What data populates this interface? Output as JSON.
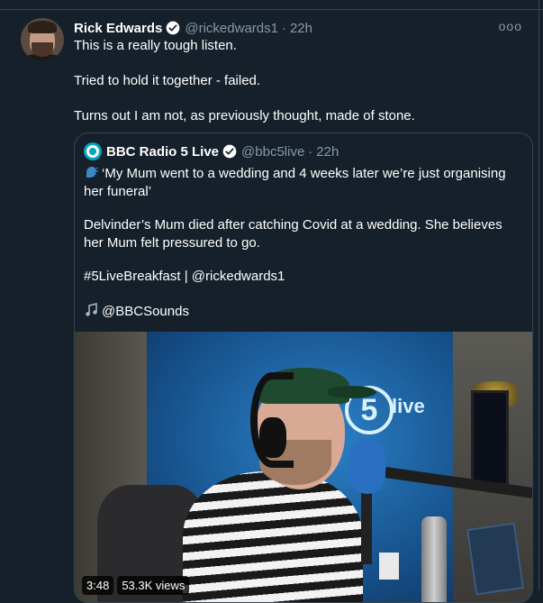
{
  "tweet": {
    "author_name": "Rick Edwards",
    "author_handle": "@rickedwards1",
    "separator": "·",
    "time": "22h",
    "more": "ooo",
    "lines": [
      "This is a really tough listen.",
      "Tried to hold it together - failed.",
      "Turns out I am not, as previously thought, made of stone."
    ]
  },
  "quoted": {
    "author_name": "BBC Radio 5 Live",
    "author_handle": "@bbc5live",
    "separator": "·",
    "time": "22h",
    "lines": [
      "‘My Mum went to a wedding and 4 weeks later we’re just organising her funeral’",
      "Delvinder’s Mum died after catching Covid at a wedding.  She believes her Mum felt pressured to go.",
      "#5LiveBreakfast | @rickedwards1",
      "@BBCSounds"
    ],
    "media": {
      "logo_number": "5",
      "logo_word": "live",
      "duration": "3:48",
      "views": "53.3K views"
    }
  },
  "colors": {
    "background": "#15202b",
    "border": "#38444d",
    "secondary_text": "#8899a6",
    "verified_blue": "#1da1f2"
  },
  "icons": [
    "verified-icon",
    "more-icon",
    "speaking-head-icon",
    "music-note-icon"
  ]
}
